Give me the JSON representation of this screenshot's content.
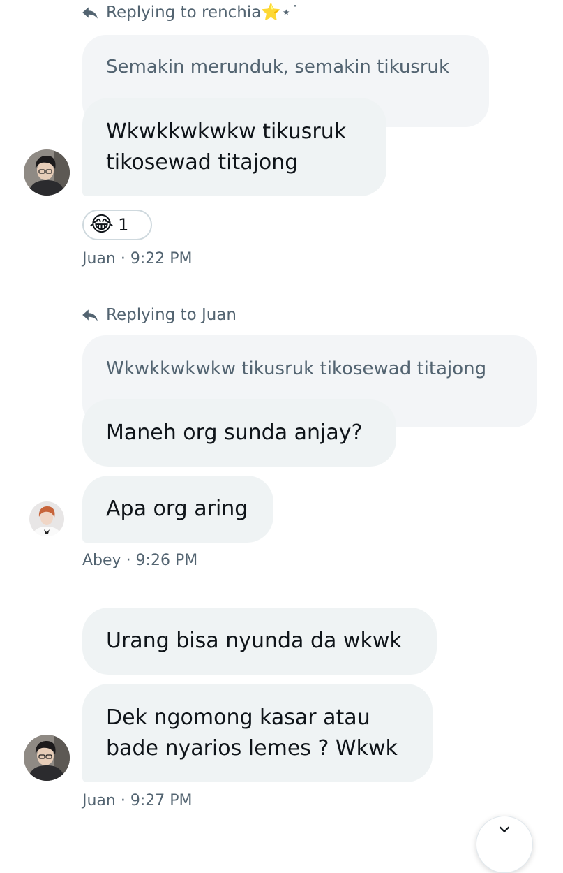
{
  "thread": {
    "group1": {
      "reply_to": "Replying to renchia⭐⋆˙",
      "quoted_text": "Semakin merunduk, semakin tikusruk",
      "message": "Wkwkkwkwkw tikusruk\ntikosewad titajong",
      "reaction_emoji": "😂",
      "reaction_count": "1",
      "meta": "Juan · 9:22 PM"
    },
    "group2": {
      "reply_to": "Replying to Juan",
      "quoted_text": "Wkwkkwkwkw tikusruk tikosewad titajong",
      "message1": "Maneh org sunda anjay?",
      "message2": "Apa org aring",
      "meta": "Abey · 9:26 PM"
    },
    "group3": {
      "message1": "Urang bisa nyunda da wkwk",
      "message2": "Dek ngomong kasar atau\nbade nyarios lemes ? Wkwk",
      "meta": "Juan · 9:27 PM"
    }
  },
  "icons": {
    "reply": "reply-arrow-icon",
    "scroll": "chevron-down-icon"
  },
  "colors": {
    "bubble": "#eff3f4",
    "quote": "#f3f5f7",
    "secondary_text": "#536471"
  }
}
